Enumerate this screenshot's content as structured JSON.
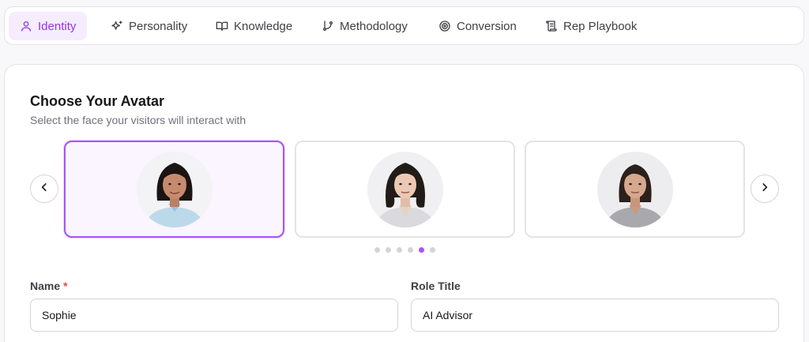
{
  "tabs": [
    {
      "label": "Identity",
      "icon": "user-icon",
      "active": true
    },
    {
      "label": "Personality",
      "icon": "sparkles-icon",
      "active": false
    },
    {
      "label": "Knowledge",
      "icon": "book-open-icon",
      "active": false
    },
    {
      "label": "Methodology",
      "icon": "git-branch-icon",
      "active": false
    },
    {
      "label": "Conversion",
      "icon": "target-icon",
      "active": false
    },
    {
      "label": "Rep Playbook",
      "icon": "scroll-icon",
      "active": false
    }
  ],
  "avatar_section": {
    "title": "Choose Your Avatar",
    "subtitle": "Select the face your visitors will interact with",
    "avatars": [
      {
        "selected": true,
        "shirt_color": "#bcd9ea"
      },
      {
        "selected": false,
        "shirt_color": "#d9d9de"
      },
      {
        "selected": false,
        "shirt_color": "#a8a8ad"
      }
    ],
    "pagination": {
      "total": 6,
      "active_index": 4
    }
  },
  "form": {
    "name_label": "Name",
    "name_required_mark": "*",
    "name_value": "Sophie",
    "role_label": "Role Title",
    "role_value": "AI Advisor"
  },
  "colors": {
    "accent": "#a855f7",
    "accent_bg": "#f5edfd",
    "required": "#ef4444"
  }
}
